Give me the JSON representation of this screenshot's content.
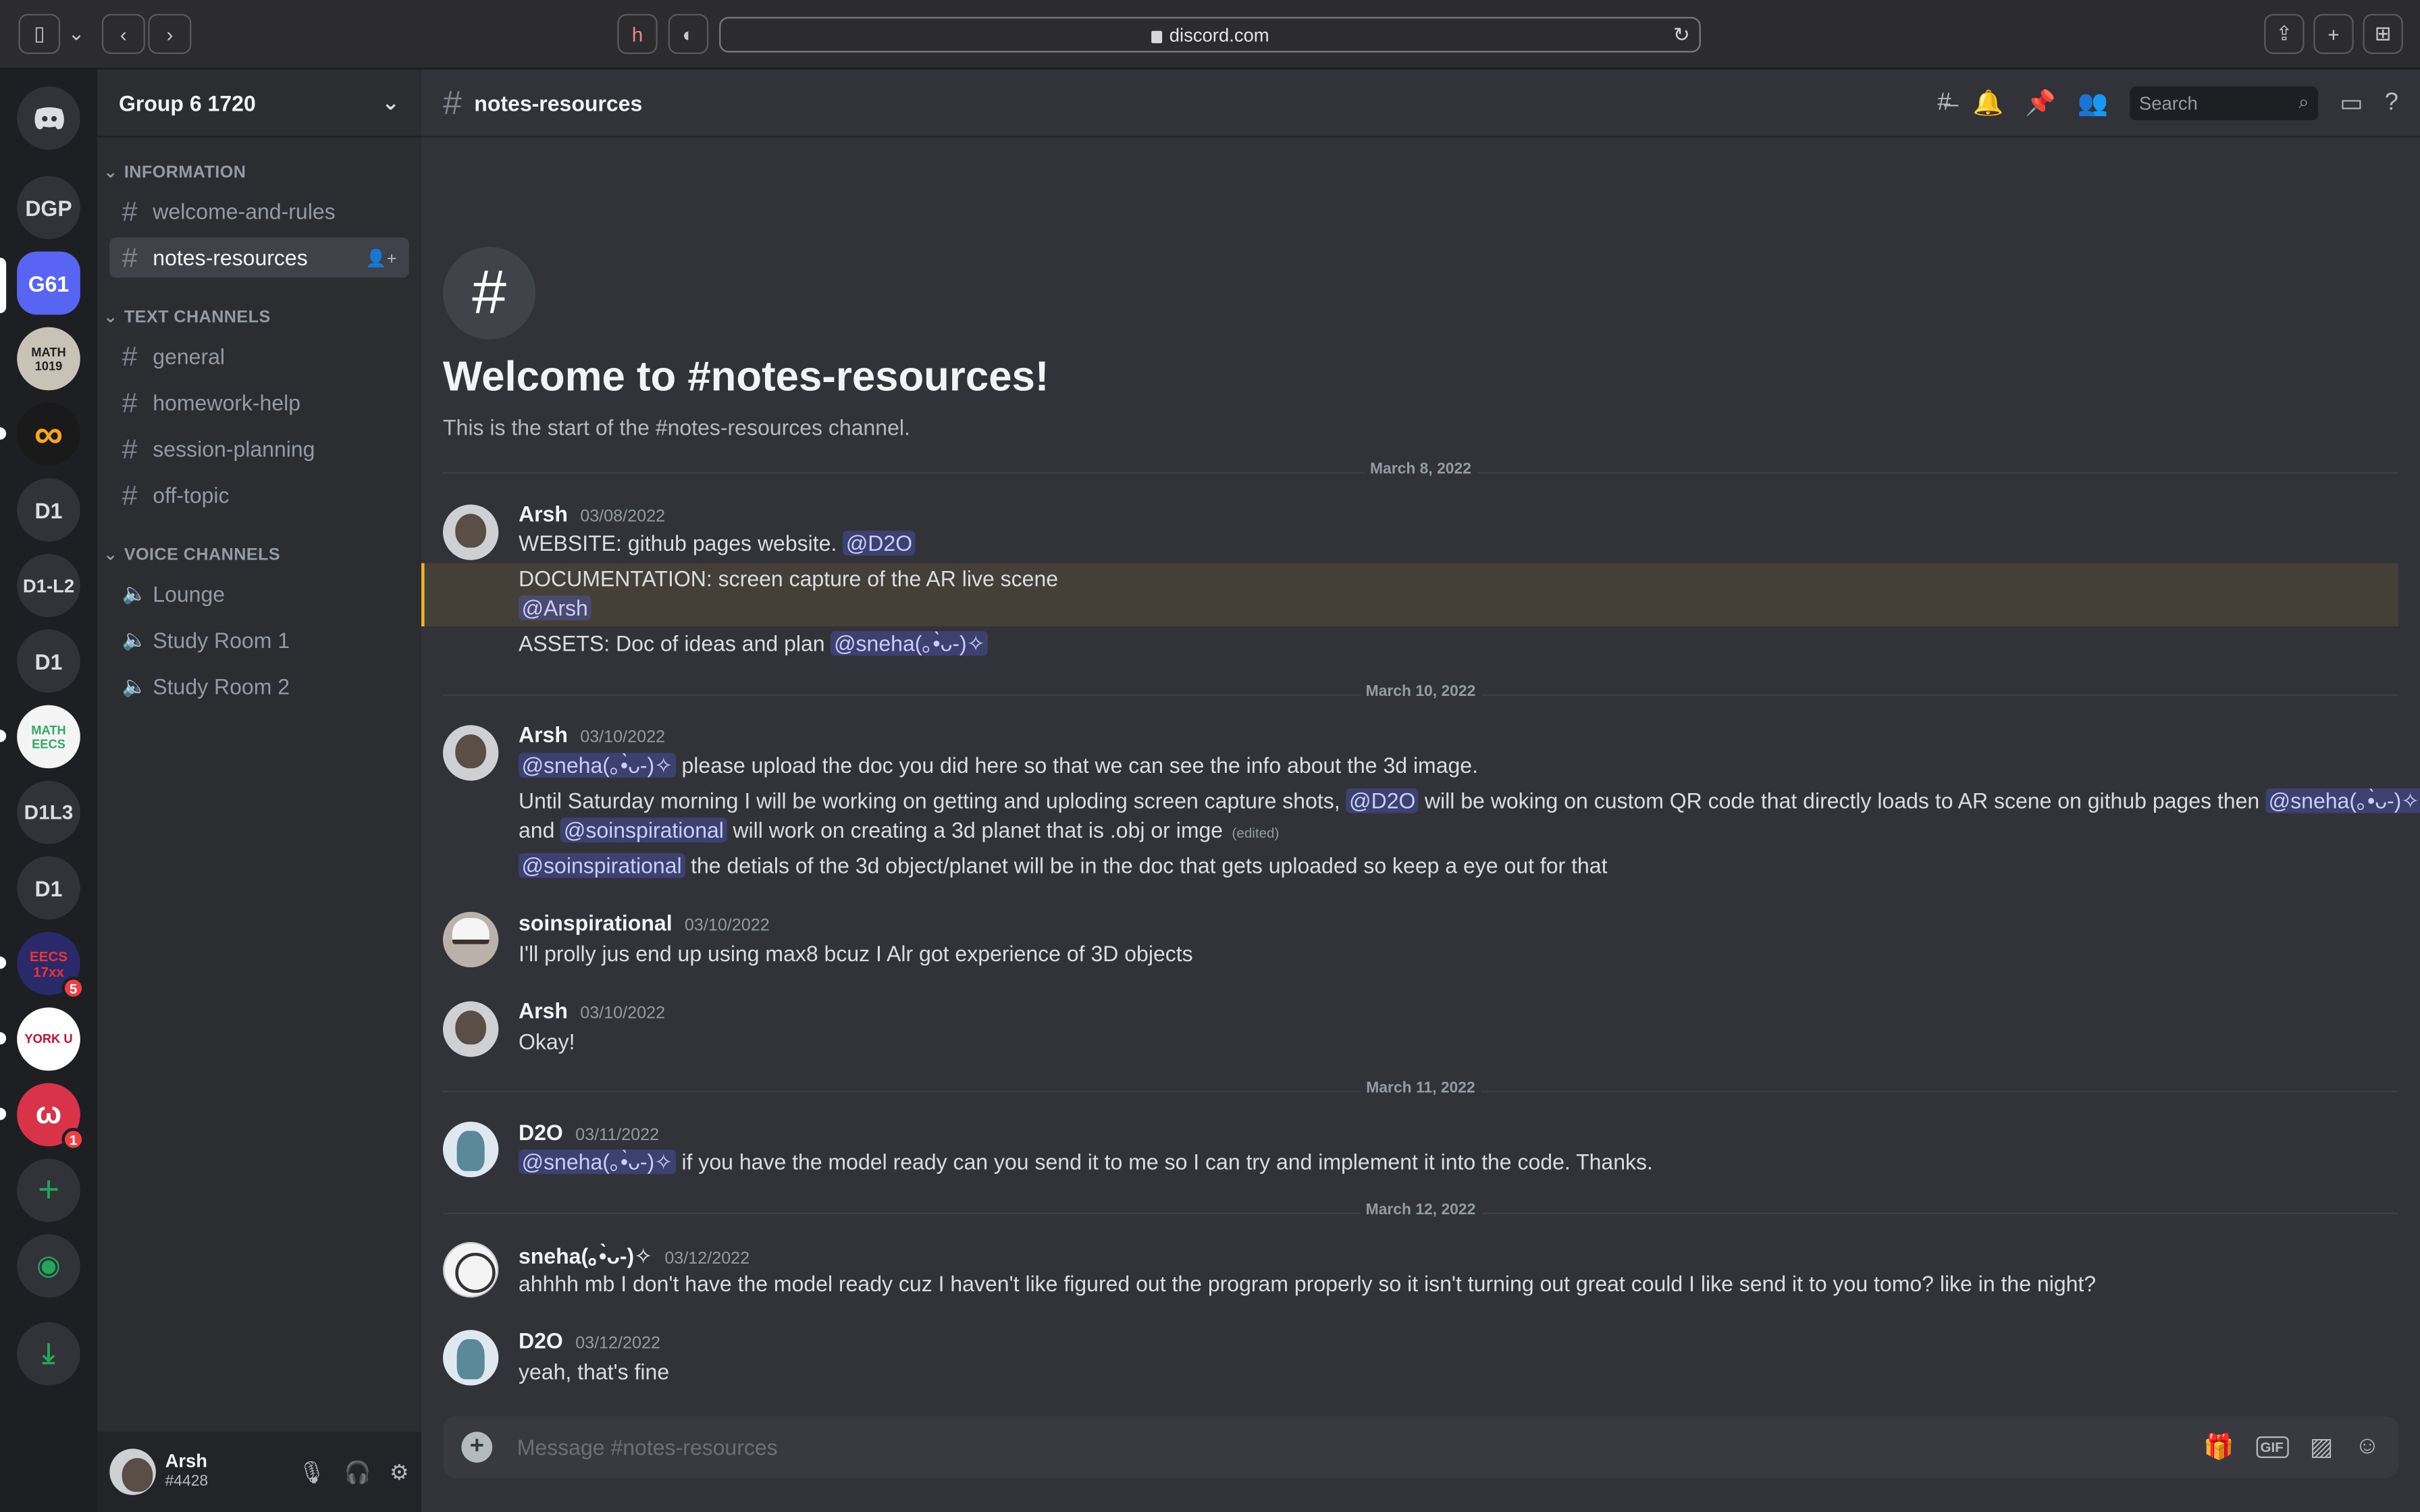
{
  "browser": {
    "url": "discord.com"
  },
  "servers": [
    {
      "label": "",
      "icon": "discord-logo"
    },
    {
      "label": "DGP"
    },
    {
      "label": "G61",
      "active": true
    },
    {
      "label": "MATH 1019"
    },
    {
      "label": "∞"
    },
    {
      "label": "D1"
    },
    {
      "label": "D1-L2"
    },
    {
      "label": "D1"
    },
    {
      "label": "MATH EECS"
    },
    {
      "label": "D1L3"
    },
    {
      "label": "D1"
    },
    {
      "label": "EECS 17xx",
      "badge": "5"
    },
    {
      "label": "YORK U"
    },
    {
      "label": "",
      "badge": "1"
    },
    {
      "label": "+"
    },
    {
      "label": "",
      "icon": "explore"
    },
    {
      "label": "",
      "icon": "download"
    }
  ],
  "guild": {
    "name": "Group 6 1720"
  },
  "categories": {
    "information": "INFORMATION",
    "text": "TEXT CHANNELS",
    "voice": "VOICE CHANNELS"
  },
  "channels": {
    "information": [
      "welcome-and-rules",
      "notes-resources"
    ],
    "text": [
      "general",
      "homework-help",
      "session-planning",
      "off-topic"
    ],
    "voice": [
      "Lounge",
      "Study Room 1",
      "Study Room 2"
    ]
  },
  "user": {
    "name": "Arsh",
    "tag": "#4428"
  },
  "header": {
    "channel": "notes-resources",
    "search_placeholder": "Search"
  },
  "welcome": {
    "title": "Welcome to #notes-resources!",
    "subtitle": "This is the start of the #notes-resources channel."
  },
  "dividers": [
    "March 8, 2022",
    "March 10, 2022",
    "March 11, 2022",
    "March 12, 2022"
  ],
  "messages": {
    "m1": {
      "author": "Arsh",
      "time": "03/08/2022",
      "l1_text": "WEBSITE:  github pages website. ",
      "l1_mention": "@D2O",
      "l2_text": "DOCUMENTATION: screen capture of the AR live scene",
      "l3_mention": "@Arsh",
      "l4_text": "ASSETS: Doc of ideas and plan ",
      "l4_mention": "@sneha(｡•̀ᴗ-)✧"
    },
    "m2": {
      "author": "Arsh",
      "time": "03/10/2022",
      "l1_mention": "@sneha(｡•̀ᴗ-)✧",
      "l1_text": " please upload the doc you did here so that we can see the info about the 3d image.",
      "l2_text_a": "Until Saturday morning I will be working on getting and uploding screen capture shots, ",
      "l2_mention_a": "@D2O",
      "l2_text_b": " will be woking on custom QR code that directly loads to AR scene on github pages then ",
      "l2_mention_b": "@sneha(｡•̀ᴗ-)✧",
      "l3_text_a": "and ",
      "l3_mention": "@soinspirational",
      "l3_text_b": "  will work on creating a 3d planet that is .obj or imge ",
      "l3_edited": "(edited)",
      "l4_mention": "@soinspirational",
      "l4_text": " the detials of the 3d object/planet will be in the doc that gets uploaded so keep a eye out for that"
    },
    "m3": {
      "author": "soinspirational",
      "time": "03/10/2022",
      "text": "I'll prolly jus end up using max8 bcuz I Alr got experience of 3D objects"
    },
    "m4": {
      "author": "Arsh",
      "time": "03/10/2022",
      "text": "Okay!"
    },
    "m5": {
      "author": "D2O",
      "time": "03/11/2022",
      "mention": "@sneha(｡•̀ᴗ-)✧",
      "text": " if you have the model ready can you send it to me so I can try and implement it into the code. Thanks."
    },
    "m6": {
      "author": "sneha(｡•̀ᴗ-)✧",
      "time": "03/12/2022",
      "text": "ahhhh mb I don't have the model ready cuz I haven't like figured out the program properly so it isn't turning out great could I like send it to you tomo? like in the night?"
    },
    "m7": {
      "author": "D2O",
      "time": "03/12/2022",
      "text": "yeah, that's fine"
    }
  },
  "composer": {
    "placeholder": "Message #notes-resources"
  }
}
